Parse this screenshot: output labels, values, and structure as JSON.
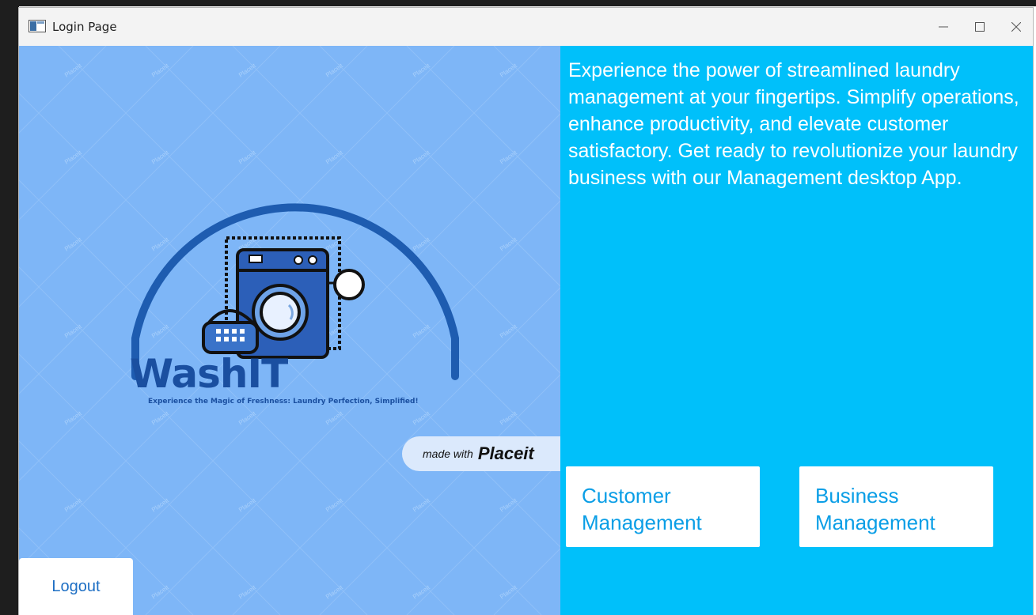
{
  "window": {
    "title": "Login Page",
    "minimize_icon": "minimize-icon",
    "maximize_icon": "maximize-icon",
    "close_icon": "close-icon"
  },
  "left_panel": {
    "brand_name": "WashIT",
    "tagline": "Experience the Magic of Freshness: Laundry Perfection, Simplified!",
    "watermark_text": "Placeit",
    "made_with_text": "made with",
    "made_with_brand": "Placeit",
    "logo_icon": "washing-machine-icon",
    "logout_label": "Logout"
  },
  "right_panel": {
    "intro_text": "Experience the power of streamlined laundry management at your fingertips. Simplify operations, enhance productivity, and elevate customer satisfactory. Get ready to revolutionize your laundry business with our Management desktop App.",
    "customer_button_label": "Customer Management",
    "business_button_label": "Business Management"
  },
  "colors": {
    "left_background": "#7eb6f7",
    "right_background": "#00c0fa",
    "brand_blue": "#1a4fa0",
    "button_text": "#0a9ee6"
  }
}
